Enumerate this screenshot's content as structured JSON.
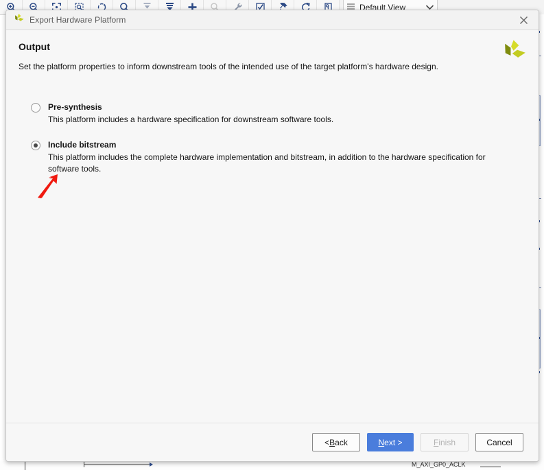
{
  "background_app": {
    "toolbar": {
      "buttons": [
        {
          "name": "zoom-in-icon",
          "tip": "Zoom In"
        },
        {
          "name": "zoom-out-icon",
          "tip": "Zoom Out"
        },
        {
          "name": "zoom-fit-icon",
          "tip": "Zoom Fit"
        },
        {
          "name": "zoom-area-icon",
          "tip": "Zoom Area"
        },
        {
          "name": "refresh-circle-icon",
          "tip": "Refresh"
        },
        {
          "name": "search-icon",
          "tip": "Search"
        },
        {
          "name": "collapse-icon",
          "tip": "Collapse"
        },
        {
          "name": "expand-icon",
          "tip": "Expand"
        },
        {
          "name": "add-icon",
          "tip": "Add IP"
        },
        {
          "name": "zoom-disabled-icon",
          "tip": "Zoom"
        },
        {
          "name": "wrench-icon",
          "tip": "Run Connection Automation"
        },
        {
          "name": "validate-icon",
          "tip": "Validate Design"
        },
        {
          "name": "pin-icon",
          "tip": "Pin"
        },
        {
          "name": "reset-icon",
          "tip": "Regenerate Layout"
        },
        {
          "name": "notes-icon",
          "tip": "Add Note"
        }
      ],
      "view_selector": {
        "label": "Default View",
        "icon": "list-icon",
        "chevron": "chevron-down-icon"
      }
    },
    "canvas_label": "M_AXI_GP0_ACLK"
  },
  "dialog": {
    "titlebar": {
      "logo": "xilinx-pinwheel-icon",
      "title": "Export Hardware Platform",
      "close_icon": "close-icon"
    },
    "header": {
      "heading": "Output",
      "description": "Set the platform properties to inform downstream tools of the intended use of the target platform's hardware design.",
      "logo": "xilinx-pinwheel-icon"
    },
    "options": [
      {
        "id": "pre-synthesis",
        "title": "Pre-synthesis",
        "description": "This platform includes a hardware specification for downstream software tools.",
        "selected": false
      },
      {
        "id": "include-bitstream",
        "title": "Include bitstream",
        "description": "This platform includes the complete hardware implementation and bitstream, in addition to the hardware specification for software tools.",
        "selected": true
      }
    ],
    "footer": {
      "buttons": [
        {
          "id": "back",
          "prefix": "< ",
          "mnemonic": "B",
          "suffix": "ack",
          "state": "normal"
        },
        {
          "id": "next",
          "prefix": "",
          "mnemonic": "N",
          "suffix": "ext >",
          "state": "primary"
        },
        {
          "id": "finish",
          "prefix": "",
          "mnemonic": "F",
          "suffix": "inish",
          "state": "disabled"
        },
        {
          "id": "cancel",
          "prefix": "",
          "mnemonic": "",
          "suffix": "Cancel",
          "state": "normal"
        }
      ]
    }
  },
  "colors": {
    "accent_blue": "#4a7ddc",
    "logo_light": "#d6dc2a",
    "logo_mid": "#c3cc22",
    "logo_dark": "#7f8c0e",
    "cursor_red": "#f01a10",
    "toolbar_icon": "#2c4a86"
  }
}
